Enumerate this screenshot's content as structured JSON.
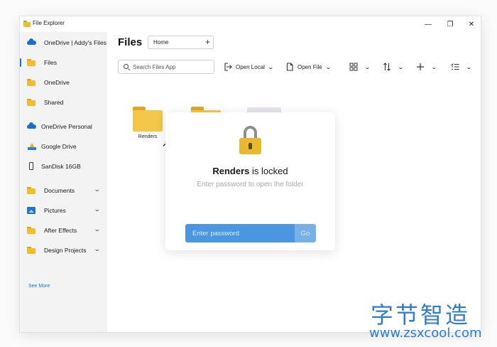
{
  "window": {
    "title": "File Explorer",
    "controls": {
      "minimize": "—",
      "maximize": "❐",
      "close": "✕"
    }
  },
  "sidebar": {
    "items": [
      {
        "label": "OneDrive | Addy's Files",
        "icon": "onedrive-cloud-icon"
      },
      {
        "label": "Files",
        "icon": "folder-icon",
        "active": true
      },
      {
        "label": "OneDrive",
        "icon": "folder-icon"
      },
      {
        "label": "Shared",
        "icon": "folder-icon"
      },
      {
        "label": "OneDrive Personal",
        "icon": "onedrive-cloud-icon"
      },
      {
        "label": "Google Drive",
        "icon": "google-drive-icon"
      },
      {
        "label": "SanDisk 16GB",
        "icon": "usb-drive-icon"
      },
      {
        "label": "Documents",
        "icon": "folder-icon",
        "expandable": true
      },
      {
        "label": "Pictures",
        "icon": "pictures-icon",
        "expandable": true
      },
      {
        "label": "After Effects",
        "icon": "folder-icon",
        "expandable": true
      },
      {
        "label": "Design Projects",
        "icon": "folder-icon",
        "expandable": true
      }
    ],
    "see_more": "See More",
    "bottom_icons": [
      "download-icon",
      "trash-icon"
    ]
  },
  "header": {
    "title": "Files",
    "tab": {
      "label": "Home",
      "add": "+"
    }
  },
  "toolbar": {
    "search_placeholder": "Search Files App",
    "open_local": "Open Local",
    "open_file": "Open File",
    "view_icon": "grid-view-icon",
    "sort_icon": "sort-icon",
    "new_icon": "plus-icon",
    "select_icon": "checklist-icon"
  },
  "files": [
    {
      "name": "Renders",
      "type": "folder"
    }
  ],
  "lock_dialog": {
    "folder_name": "Renders",
    "title_suffix": " is locked",
    "subtitle": "Enter password to open the folder",
    "password_placeholder": "Enter password",
    "go_label": "Go"
  },
  "watermark": {
    "big": "字节智造",
    "small": "www.zsxcool.com"
  },
  "colors": {
    "accent": "#1f6fc8",
    "input_blue": "#4a96e0",
    "go_blue": "#78b1e8",
    "folder_yellow": "#f4c64a"
  }
}
